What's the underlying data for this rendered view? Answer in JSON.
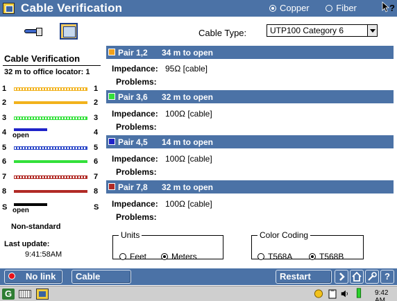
{
  "window": {
    "title": "Cable Verification",
    "media_options": [
      {
        "label": "Copper",
        "selected": true
      },
      {
        "label": "Fiber",
        "selected": false
      }
    ],
    "help_cursor": "k?"
  },
  "left": {
    "title": "Cable Verification",
    "subtitle": "32 m to office locator: 1",
    "wires": [
      {
        "left": "1",
        "right": "1",
        "color": "#f2b21c",
        "style": "striped",
        "note": ""
      },
      {
        "left": "2",
        "right": "2",
        "color": "#f2b21c",
        "style": "solid",
        "note": ""
      },
      {
        "left": "3",
        "right": "3",
        "color": "#33e03a",
        "style": "striped",
        "note": ""
      },
      {
        "left": "4",
        "right": "4",
        "color": "#1f23c9",
        "style": "short",
        "note": "open"
      },
      {
        "left": "5",
        "right": "5",
        "color": "#2b47c8",
        "style": "striped",
        "note": ""
      },
      {
        "left": "6",
        "right": "6",
        "color": "#33e03a",
        "style": "solid",
        "note": ""
      },
      {
        "left": "7",
        "right": "7",
        "color": "#b12a25",
        "style": "striped",
        "note": ""
      },
      {
        "left": "8",
        "right": "8",
        "color": "#b12a25",
        "style": "solid",
        "note": ""
      },
      {
        "left": "S",
        "right": "S",
        "color": "#000000",
        "style": "short",
        "note": "open"
      }
    ],
    "nonstandard": "Non-standard",
    "last_update_label": "Last update:",
    "last_update_time": "9:41:58AM"
  },
  "cable_type": {
    "label": "Cable Type:",
    "value": "UTP100 Category 6"
  },
  "pairs": [
    {
      "name": "Pair 1,2",
      "distance": "34 m to open",
      "swatch": "#f2a21c",
      "impedance_label": "Impedance:",
      "impedance_value": "95Ω  [cable]",
      "problems_label": "Problems:"
    },
    {
      "name": "Pair 3,6",
      "distance": "32 m to open",
      "swatch": "#33e03a",
      "impedance_label": "Impedance:",
      "impedance_value": "100Ω  [cable]",
      "problems_label": "Problems:"
    },
    {
      "name": "Pair 4,5",
      "distance": "14 m to open",
      "swatch": "#1f23c9",
      "impedance_label": "Impedance:",
      "impedance_value": "100Ω  [cable]",
      "problems_label": "Problems:"
    },
    {
      "name": "Pair 7,8",
      "distance": "32 m to open",
      "swatch": "#b12a25",
      "impedance_label": "Impedance:",
      "impedance_value": "100Ω  [cable]",
      "problems_label": "Problems:"
    }
  ],
  "units": {
    "legend": "Units",
    "options": [
      {
        "label": "Feet",
        "selected": false
      },
      {
        "label": "Meters",
        "selected": true
      }
    ]
  },
  "color_coding": {
    "legend": "Color Coding",
    "options": [
      {
        "label": "T568A",
        "selected": false
      },
      {
        "label": "T568B",
        "selected": true
      }
    ]
  },
  "toolbar": {
    "no_link": "No link",
    "cable_toner": "Cable Toner",
    "restart_test": "Restart Test",
    "help": "?"
  },
  "taskbar": {
    "clock": "9:42 AM"
  },
  "colors": {
    "accent": "#4b72a6",
    "taskbar": "#cfcfcf"
  }
}
